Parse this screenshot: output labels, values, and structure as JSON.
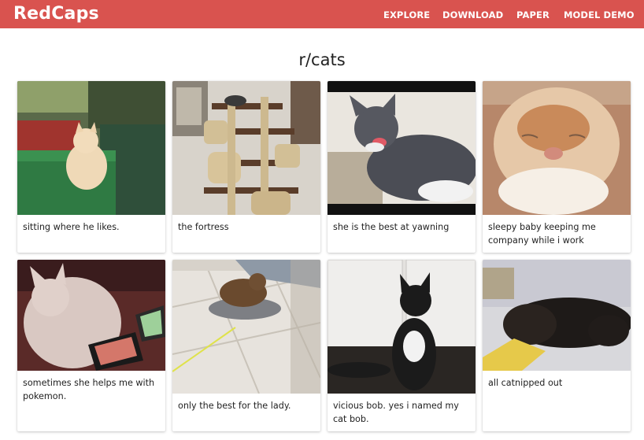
{
  "brand": "RedCaps",
  "nav": {
    "explore": "EXPLORE",
    "download": "DOWNLOAD",
    "paper": "PAPER",
    "model_demo": "MODEL DEMO"
  },
  "page_title": "r/cats",
  "cards": [
    {
      "caption": "sitting where he likes."
    },
    {
      "caption": "the fortress"
    },
    {
      "caption": "she is the best at yawning"
    },
    {
      "caption": "sleepy baby keeping me company while i work"
    },
    {
      "caption": "sometimes she helps me with pokemon."
    },
    {
      "caption": "only the best for the lady."
    },
    {
      "caption": "vicious bob. yes i named my cat bob."
    },
    {
      "caption": "all catnipped out"
    }
  ],
  "colors": {
    "navbar": "#d9534f",
    "text": "#222222"
  }
}
